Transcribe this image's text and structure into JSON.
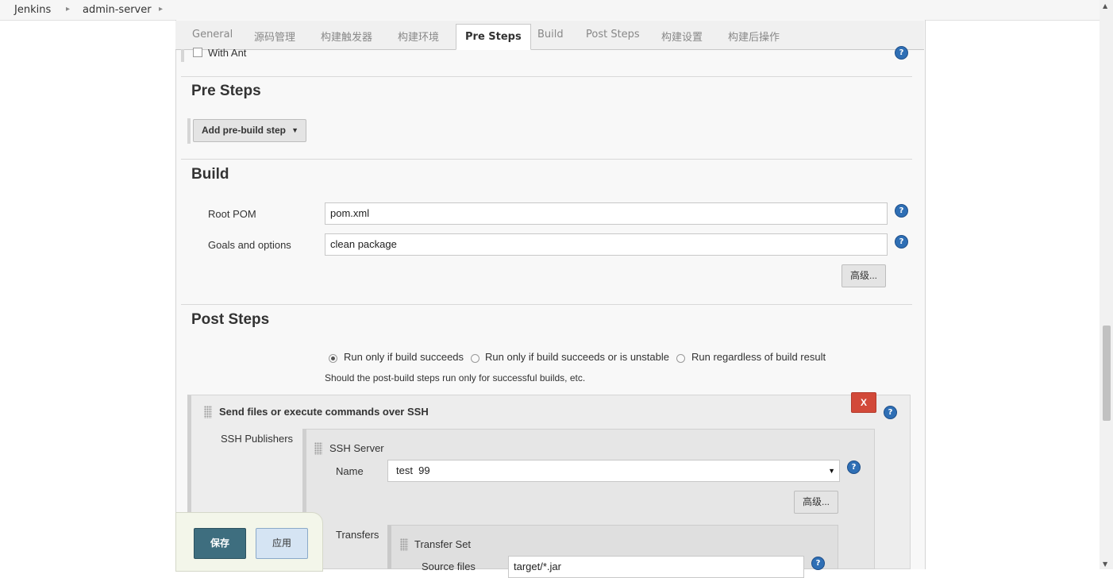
{
  "breadcrumb": {
    "items": [
      "Jenkins",
      "admin-server"
    ]
  },
  "tabs": [
    "General",
    "源码管理",
    "构建触发器",
    "构建环境",
    "Pre Steps",
    "Build",
    "Post Steps",
    "构建设置",
    "构建后操作"
  ],
  "active_tab": "Pre Steps",
  "with_ant": {
    "label": "With Ant",
    "checked": false
  },
  "pre_steps": {
    "title": "Pre Steps",
    "add_button": "Add pre-build step"
  },
  "build": {
    "title": "Build",
    "root_pom_label": "Root POM",
    "root_pom_value": "pom.xml",
    "goals_label": "Goals and options",
    "goals_value": "clean package",
    "advanced_button": "高级..."
  },
  "post_steps": {
    "title": "Post Steps",
    "options": [
      {
        "label": "Run only if build succeeds",
        "selected": true
      },
      {
        "label": "Run only if build succeeds or is unstable",
        "selected": false
      },
      {
        "label": "Run regardless of build result",
        "selected": false
      }
    ],
    "description": "Should the post-build steps run only for successful builds, etc."
  },
  "ssh": {
    "title": "Send files or execute commands over SSH",
    "delete_button": "X",
    "publishers_label": "SSH Publishers",
    "server_title": "SSH Server",
    "name_label": "Name",
    "name_value": "test  99",
    "advanced_button": "高级...",
    "transfers_label": "Transfers",
    "transfer_set_title": "Transfer Set",
    "source_files_label": "Source files",
    "source_files_value": "target/*.jar"
  },
  "actions": {
    "save": "保存",
    "apply": "应用"
  },
  "help_glyph": "?",
  "colors": {
    "save_button": "#3e6e7f",
    "apply_button": "#d5e4f3",
    "delete_button": "#d24939",
    "help_icon": "#2f6fb5"
  }
}
